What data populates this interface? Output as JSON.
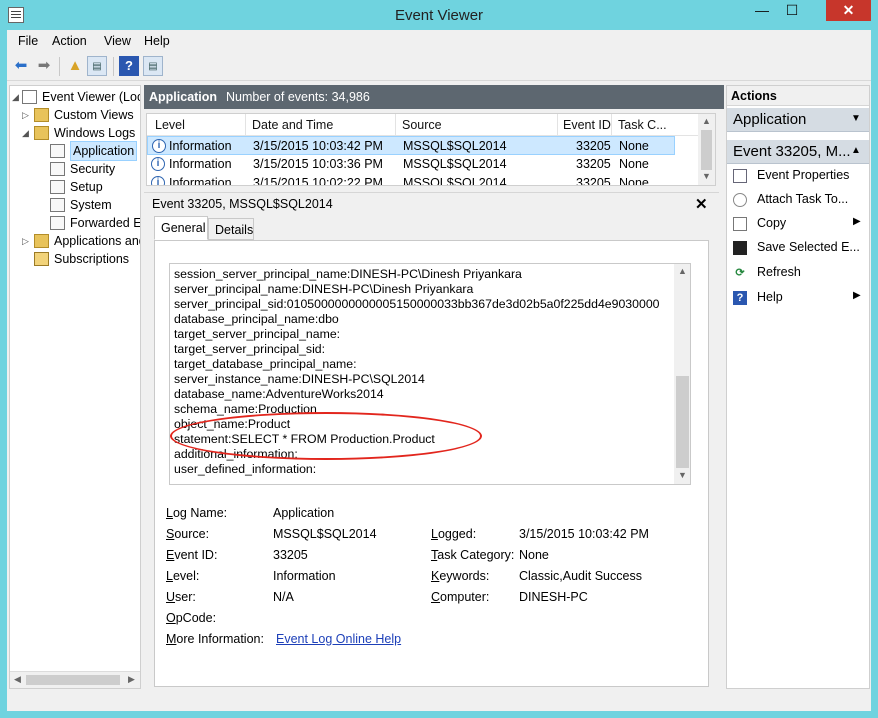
{
  "window": {
    "title": "Event Viewer",
    "min_label": "—",
    "max_label": "☐",
    "close_label": "✕"
  },
  "menu": [
    "File",
    "Action",
    "View",
    "Help"
  ],
  "tree": {
    "items": [
      {
        "label": "Event Viewer (Local)",
        "icon": "event-viewer-icon"
      },
      {
        "label": "Custom Views",
        "icon": "folder-icon"
      },
      {
        "label": "Windows Logs",
        "icon": "folder-icon"
      },
      {
        "label": "Application",
        "icon": "log-icon",
        "selected": true
      },
      {
        "label": "Security",
        "icon": "log-icon"
      },
      {
        "label": "Setup",
        "icon": "log-icon"
      },
      {
        "label": "System",
        "icon": "log-icon"
      },
      {
        "label": "Forwarded Events",
        "icon": "log-icon"
      },
      {
        "label": "Applications and Services Logs",
        "icon": "folder-icon"
      },
      {
        "label": "Subscriptions",
        "icon": "subscriptions-icon"
      }
    ]
  },
  "log": {
    "title": "Application",
    "count": "Number of events: 34,986"
  },
  "grid": {
    "columns": [
      "Level",
      "Date and Time",
      "Source",
      "Event ID",
      "Task C..."
    ],
    "rows": [
      {
        "level": "Information",
        "datetime": "3/15/2015 10:03:42 PM",
        "source": "MSSQL$SQL2014",
        "event_id": "33205",
        "task": "None",
        "selected": true
      },
      {
        "level": "Information",
        "datetime": "3/15/2015 10:03:36 PM",
        "source": "MSSQL$SQL2014",
        "event_id": "33205",
        "task": "None"
      },
      {
        "level": "Information",
        "datetime": "3/15/2015 10:02:22 PM",
        "source": "MSSQL$SQL2014",
        "event_id": "33205",
        "task": "None"
      }
    ]
  },
  "detail": {
    "title": "Event 33205, MSSQL$SQL2014",
    "tabs": [
      "General",
      "Details"
    ],
    "text_lines": [
      "session_server_principal_name:DINESH-PC\\Dinesh Priyankara",
      "server_principal_name:DINESH-PC\\Dinesh Priyankara",
      "server_principal_sid:0105000000000005150000033bb367de3d02b5a0f225dd4e9030000",
      "database_principal_name:dbo",
      "target_server_principal_name:",
      "target_server_principal_sid:",
      "target_database_principal_name:",
      "server_instance_name:DINESH-PC\\SQL2014",
      "database_name:AdventureWorks2014",
      "schema_name:Production",
      "object_name:Product",
      "statement:SELECT * FROM Production.Product",
      "additional_information:",
      "user_defined_information:",
      "."
    ],
    "props": {
      "log_name_label": "Log Name:",
      "log_name": "Application",
      "source_label": "Source:",
      "source": "MSSQL$SQL2014",
      "logged_label": "Logged:",
      "logged": "3/15/2015 10:03:42 PM",
      "event_id_label": "Event ID:",
      "event_id": "33205",
      "task_category_label": "Task Category:",
      "task_category": "None",
      "level_label": "Level:",
      "level": "Information",
      "keywords_label": "Keywords:",
      "keywords": "Classic,Audit Success",
      "user_label": "User:",
      "user": "N/A",
      "computer_label": "Computer:",
      "computer": "DINESH-PC",
      "opcode_label": "OpCode:",
      "opcode": "",
      "more_info_label": "More Information:",
      "more_info_link": "Event Log Online Help"
    }
  },
  "actions": {
    "header": "Actions",
    "section1": "Application",
    "section2": "Event 33205, M...",
    "items": [
      {
        "label": "Event Properties",
        "icon": "event-properties-icon"
      },
      {
        "label": "Attach Task To...",
        "icon": "attach-task-icon"
      },
      {
        "label": "Copy",
        "icon": "copy-icon",
        "submenu": true
      },
      {
        "label": "Save Selected E...",
        "icon": "save-icon"
      },
      {
        "label": "Refresh",
        "icon": "refresh-icon"
      },
      {
        "label": "Help",
        "icon": "help-icon",
        "submenu": true
      }
    ]
  },
  "colors": {
    "titlebar": "#6fd3df",
    "log_header": "#5d6770",
    "selection": "#cde8ff",
    "highlight_oval": "#e2261d",
    "link": "#1c3fb8"
  }
}
